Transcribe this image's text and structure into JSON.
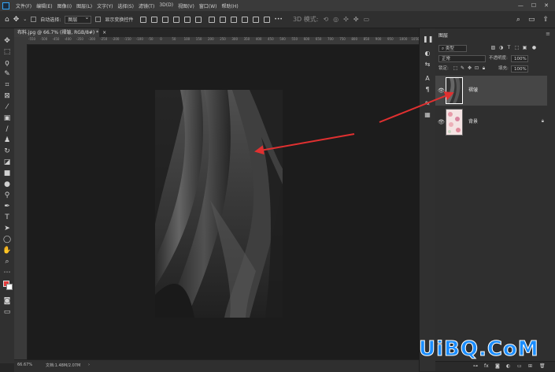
{
  "menubar": {
    "items": [
      "文件(F)",
      "编辑(E)",
      "图像(I)",
      "图层(L)",
      "文字(Y)",
      "选择(S)",
      "滤镜(T)",
      "3D(D)",
      "视图(V)",
      "窗口(W)",
      "帮助(H)"
    ],
    "window_controls": [
      "—",
      "☐",
      "✕"
    ]
  },
  "options": {
    "auto_select_label": "自动选择:",
    "auto_select_value": "图层",
    "show_transform_label": "显示变换控件",
    "mode3d_label": "3D 模式:",
    "more": "•••"
  },
  "document": {
    "tab_title": "布料.jpg @ 66.7% (褶皱, RGB/8#) *",
    "tab_close": "×"
  },
  "ruler": {
    "h_labels": [
      "-550",
      "-500",
      "-450",
      "-400",
      "-350",
      "-300",
      "-250",
      "-200",
      "-150",
      "-100",
      "-50",
      "0",
      "50",
      "100",
      "150",
      "200",
      "250",
      "300",
      "350",
      "400",
      "450",
      "500",
      "550",
      "600",
      "650",
      "700",
      "750",
      "800",
      "850",
      "900",
      "950",
      "1000",
      "1050"
    ]
  },
  "status": {
    "zoom": "66.67%",
    "doc_info": "文档:1.48M/2.07M",
    "arrow": "›"
  },
  "layers_panel": {
    "title": "图层",
    "menu_icon": "≡",
    "filter_kind": "类型",
    "blend_mode": "正常",
    "opacity_label": "不透明度:",
    "opacity_value": "100%",
    "lock_label": "锁定:",
    "fill_label": "填充:",
    "fill_value": "100%",
    "layers": [
      {
        "name": "褶皱",
        "visible": true,
        "selected": true
      },
      {
        "name": "背景",
        "visible": true,
        "selected": false,
        "locked": true
      }
    ]
  },
  "watermark": "UiBQ.CoM"
}
